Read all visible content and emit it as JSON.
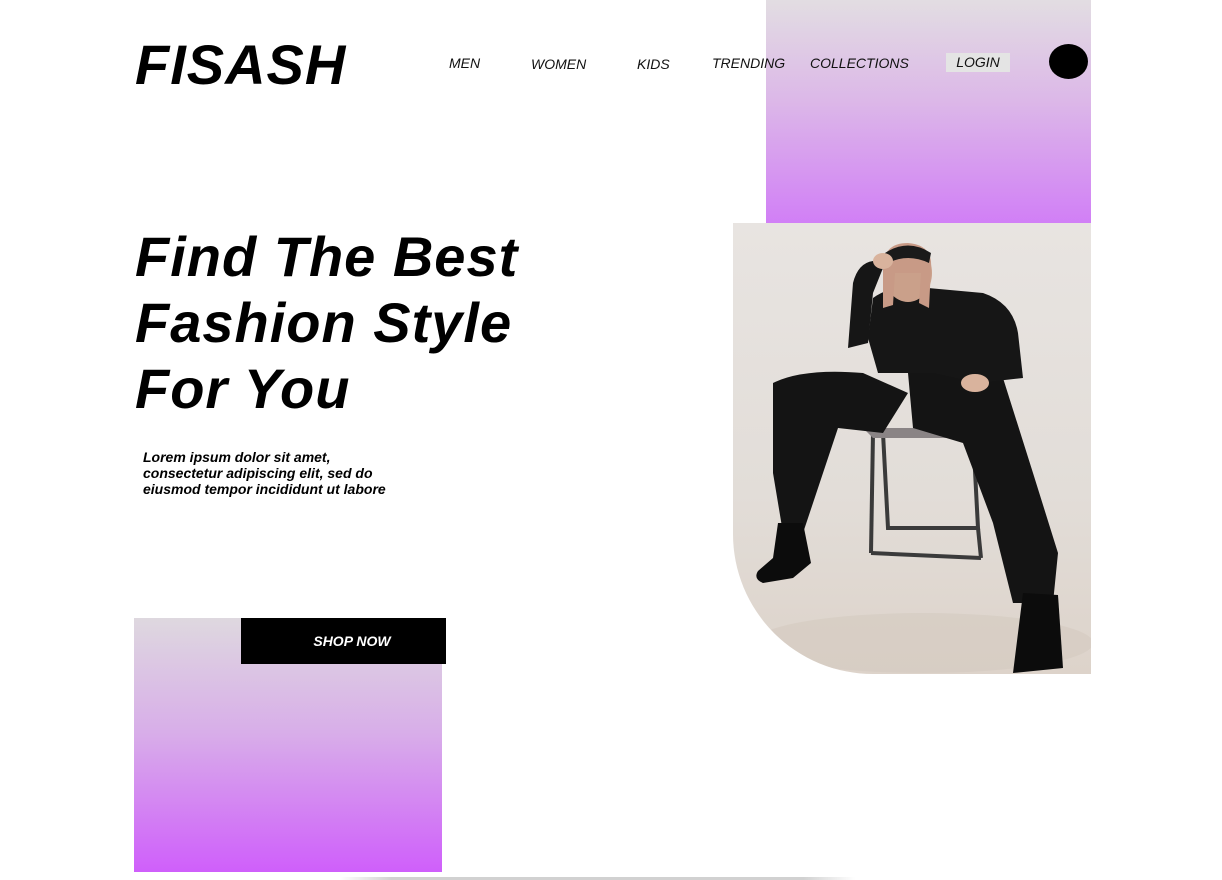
{
  "brand": {
    "logo_text": "FISASH"
  },
  "nav": {
    "items": [
      {
        "label": "MEN"
      },
      {
        "label": "WOMEN"
      },
      {
        "label": "KIDS"
      },
      {
        "label": "TRENDING"
      },
      {
        "label": "COLLECTIONS"
      }
    ],
    "login_label": "LOGIN"
  },
  "hero": {
    "headline_lines": [
      "Find The Best",
      "Fashion Style",
      "For You"
    ],
    "description_lines": [
      "Lorem ipsum dolor sit amet,",
      "consectetur adipiscing elit, sed do",
      "eiusmod tempor incididunt ut labore"
    ],
    "cta_label": "SHOP NOW"
  },
  "colors": {
    "accent_gradient_start": "#e2dde2",
    "accent_gradient_end": "#d17ff6",
    "accent_gradient_end_bottom": "#cf5ffb",
    "text": "#000000",
    "button_bg": "#000000",
    "button_text": "#ffffff",
    "login_bg": "#e4e4e4"
  },
  "icons": {
    "avatar": "user-avatar-icon",
    "hero_image": "fashion-model-photo"
  }
}
